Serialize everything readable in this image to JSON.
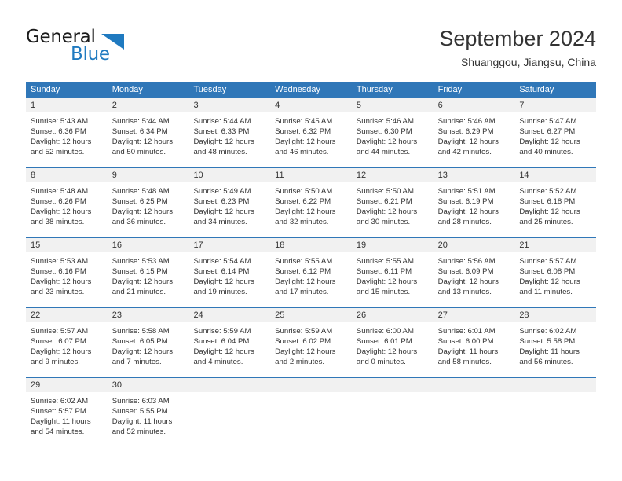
{
  "brand": {
    "name_top": "General",
    "name_bottom": "Blue",
    "accent_color": "#1f7ac0",
    "triangle_icon": "triangle-icon"
  },
  "header": {
    "title": "September 2024",
    "subtitle": "Shuanggou, Jiangsu, China"
  },
  "theme": {
    "header_blue": "#3077b8",
    "day_band_gray": "#f1f1f1",
    "text_color": "#333333"
  },
  "weekdays": [
    "Sunday",
    "Monday",
    "Tuesday",
    "Wednesday",
    "Thursday",
    "Friday",
    "Saturday"
  ],
  "weeks": [
    [
      {
        "day": "1",
        "sunrise": "Sunrise: 5:43 AM",
        "sunset": "Sunset: 6:36 PM",
        "daylight1": "Daylight: 12 hours",
        "daylight2": "and 52 minutes."
      },
      {
        "day": "2",
        "sunrise": "Sunrise: 5:44 AM",
        "sunset": "Sunset: 6:34 PM",
        "daylight1": "Daylight: 12 hours",
        "daylight2": "and 50 minutes."
      },
      {
        "day": "3",
        "sunrise": "Sunrise: 5:44 AM",
        "sunset": "Sunset: 6:33 PM",
        "daylight1": "Daylight: 12 hours",
        "daylight2": "and 48 minutes."
      },
      {
        "day": "4",
        "sunrise": "Sunrise: 5:45 AM",
        "sunset": "Sunset: 6:32 PM",
        "daylight1": "Daylight: 12 hours",
        "daylight2": "and 46 minutes."
      },
      {
        "day": "5",
        "sunrise": "Sunrise: 5:46 AM",
        "sunset": "Sunset: 6:30 PM",
        "daylight1": "Daylight: 12 hours",
        "daylight2": "and 44 minutes."
      },
      {
        "day": "6",
        "sunrise": "Sunrise: 5:46 AM",
        "sunset": "Sunset: 6:29 PM",
        "daylight1": "Daylight: 12 hours",
        "daylight2": "and 42 minutes."
      },
      {
        "day": "7",
        "sunrise": "Sunrise: 5:47 AM",
        "sunset": "Sunset: 6:27 PM",
        "daylight1": "Daylight: 12 hours",
        "daylight2": "and 40 minutes."
      }
    ],
    [
      {
        "day": "8",
        "sunrise": "Sunrise: 5:48 AM",
        "sunset": "Sunset: 6:26 PM",
        "daylight1": "Daylight: 12 hours",
        "daylight2": "and 38 minutes."
      },
      {
        "day": "9",
        "sunrise": "Sunrise: 5:48 AM",
        "sunset": "Sunset: 6:25 PM",
        "daylight1": "Daylight: 12 hours",
        "daylight2": "and 36 minutes."
      },
      {
        "day": "10",
        "sunrise": "Sunrise: 5:49 AM",
        "sunset": "Sunset: 6:23 PM",
        "daylight1": "Daylight: 12 hours",
        "daylight2": "and 34 minutes."
      },
      {
        "day": "11",
        "sunrise": "Sunrise: 5:50 AM",
        "sunset": "Sunset: 6:22 PM",
        "daylight1": "Daylight: 12 hours",
        "daylight2": "and 32 minutes."
      },
      {
        "day": "12",
        "sunrise": "Sunrise: 5:50 AM",
        "sunset": "Sunset: 6:21 PM",
        "daylight1": "Daylight: 12 hours",
        "daylight2": "and 30 minutes."
      },
      {
        "day": "13",
        "sunrise": "Sunrise: 5:51 AM",
        "sunset": "Sunset: 6:19 PM",
        "daylight1": "Daylight: 12 hours",
        "daylight2": "and 28 minutes."
      },
      {
        "day": "14",
        "sunrise": "Sunrise: 5:52 AM",
        "sunset": "Sunset: 6:18 PM",
        "daylight1": "Daylight: 12 hours",
        "daylight2": "and 25 minutes."
      }
    ],
    [
      {
        "day": "15",
        "sunrise": "Sunrise: 5:53 AM",
        "sunset": "Sunset: 6:16 PM",
        "daylight1": "Daylight: 12 hours",
        "daylight2": "and 23 minutes."
      },
      {
        "day": "16",
        "sunrise": "Sunrise: 5:53 AM",
        "sunset": "Sunset: 6:15 PM",
        "daylight1": "Daylight: 12 hours",
        "daylight2": "and 21 minutes."
      },
      {
        "day": "17",
        "sunrise": "Sunrise: 5:54 AM",
        "sunset": "Sunset: 6:14 PM",
        "daylight1": "Daylight: 12 hours",
        "daylight2": "and 19 minutes."
      },
      {
        "day": "18",
        "sunrise": "Sunrise: 5:55 AM",
        "sunset": "Sunset: 6:12 PM",
        "daylight1": "Daylight: 12 hours",
        "daylight2": "and 17 minutes."
      },
      {
        "day": "19",
        "sunrise": "Sunrise: 5:55 AM",
        "sunset": "Sunset: 6:11 PM",
        "daylight1": "Daylight: 12 hours",
        "daylight2": "and 15 minutes."
      },
      {
        "day": "20",
        "sunrise": "Sunrise: 5:56 AM",
        "sunset": "Sunset: 6:09 PM",
        "daylight1": "Daylight: 12 hours",
        "daylight2": "and 13 minutes."
      },
      {
        "day": "21",
        "sunrise": "Sunrise: 5:57 AM",
        "sunset": "Sunset: 6:08 PM",
        "daylight1": "Daylight: 12 hours",
        "daylight2": "and 11 minutes."
      }
    ],
    [
      {
        "day": "22",
        "sunrise": "Sunrise: 5:57 AM",
        "sunset": "Sunset: 6:07 PM",
        "daylight1": "Daylight: 12 hours",
        "daylight2": "and 9 minutes."
      },
      {
        "day": "23",
        "sunrise": "Sunrise: 5:58 AM",
        "sunset": "Sunset: 6:05 PM",
        "daylight1": "Daylight: 12 hours",
        "daylight2": "and 7 minutes."
      },
      {
        "day": "24",
        "sunrise": "Sunrise: 5:59 AM",
        "sunset": "Sunset: 6:04 PM",
        "daylight1": "Daylight: 12 hours",
        "daylight2": "and 4 minutes."
      },
      {
        "day": "25",
        "sunrise": "Sunrise: 5:59 AM",
        "sunset": "Sunset: 6:02 PM",
        "daylight1": "Daylight: 12 hours",
        "daylight2": "and 2 minutes."
      },
      {
        "day": "26",
        "sunrise": "Sunrise: 6:00 AM",
        "sunset": "Sunset: 6:01 PM",
        "daylight1": "Daylight: 12 hours",
        "daylight2": "and 0 minutes."
      },
      {
        "day": "27",
        "sunrise": "Sunrise: 6:01 AM",
        "sunset": "Sunset: 6:00 PM",
        "daylight1": "Daylight: 11 hours",
        "daylight2": "and 58 minutes."
      },
      {
        "day": "28",
        "sunrise": "Sunrise: 6:02 AM",
        "sunset": "Sunset: 5:58 PM",
        "daylight1": "Daylight: 11 hours",
        "daylight2": "and 56 minutes."
      }
    ],
    [
      {
        "day": "29",
        "sunrise": "Sunrise: 6:02 AM",
        "sunset": "Sunset: 5:57 PM",
        "daylight1": "Daylight: 11 hours",
        "daylight2": "and 54 minutes."
      },
      {
        "day": "30",
        "sunrise": "Sunrise: 6:03 AM",
        "sunset": "Sunset: 5:55 PM",
        "daylight1": "Daylight: 11 hours",
        "daylight2": "and 52 minutes."
      },
      {
        "day": "",
        "sunrise": "",
        "sunset": "",
        "daylight1": "",
        "daylight2": ""
      },
      {
        "day": "",
        "sunrise": "",
        "sunset": "",
        "daylight1": "",
        "daylight2": ""
      },
      {
        "day": "",
        "sunrise": "",
        "sunset": "",
        "daylight1": "",
        "daylight2": ""
      },
      {
        "day": "",
        "sunrise": "",
        "sunset": "",
        "daylight1": "",
        "daylight2": ""
      },
      {
        "day": "",
        "sunrise": "",
        "sunset": "",
        "daylight1": "",
        "daylight2": ""
      }
    ]
  ]
}
